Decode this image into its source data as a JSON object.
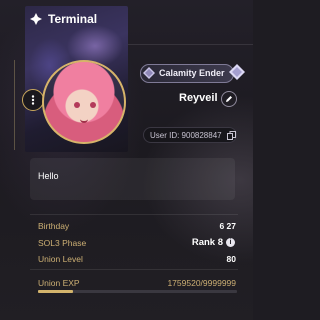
{
  "header": {
    "title": "Terminal"
  },
  "profile": {
    "title_badge": "Calamity Ender",
    "nickname": "Reyveil",
    "user_id": "User ID: 900828847",
    "signature": "Hello"
  },
  "stats": {
    "birthday_label": "Birthday",
    "birthday_value": "6 27",
    "phase_label": "SOL3 Phase",
    "phase_value": "Rank 8",
    "level_label": "Union Level",
    "level_value": "80",
    "exp_label": "Union EXP",
    "exp_value": "1759520/9999999",
    "exp_fraction": 0.176
  },
  "colors": {
    "accent_gold": "#cdb074",
    "background": "#1e1c22"
  },
  "icons": [
    "diamond-logo-icon",
    "more-vertical-icon",
    "pencil-icon",
    "copy-icon",
    "info-icon",
    "gem-icon"
  ]
}
